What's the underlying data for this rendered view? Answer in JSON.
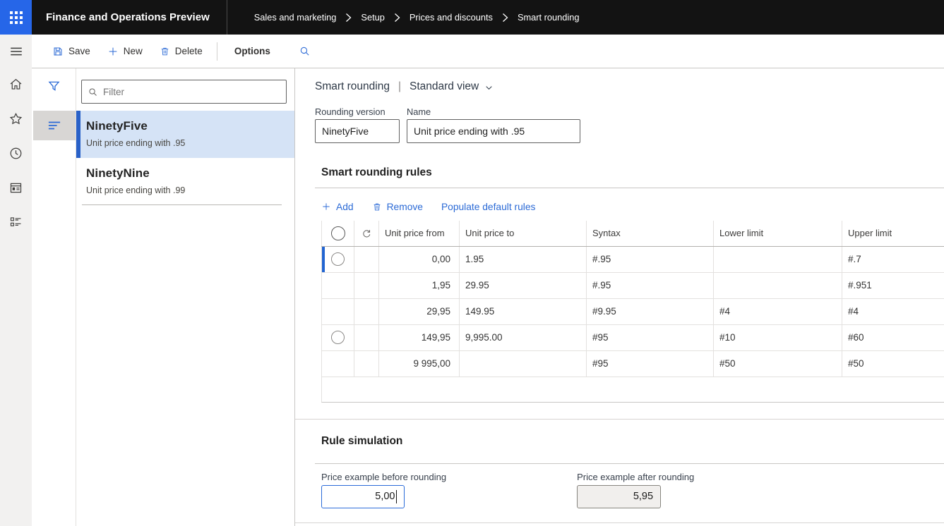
{
  "app_bar": {
    "product_title": "Finance and Operations Preview",
    "breadcrumb": [
      "Sales and marketing",
      "Setup",
      "Prices and discounts",
      "Smart rounding"
    ]
  },
  "command_bar": {
    "save_label": "Save",
    "new_label": "New",
    "delete_label": "Delete",
    "options_label": "Options"
  },
  "icons": {
    "waffle": "grid-3x3-dots",
    "nav": [
      "hamburger",
      "home",
      "star-favorites",
      "clock-recent",
      "workspace-window",
      "modules-checklist"
    ],
    "save": "floppy-disk",
    "new": "plus",
    "delete": "trash",
    "search": "magnifier",
    "filter": "funnel",
    "list_view": "list-lines",
    "view_chevron": "chevron-down",
    "breadcrumb_separator": "chevron-right",
    "grid_header": [
      "radio-circle",
      "refresh-arrow"
    ]
  },
  "master_list": {
    "filter_placeholder": "Filter",
    "items": [
      {
        "title": "NinetyFive",
        "subtitle": "Unit price ending with .95",
        "selected": true
      },
      {
        "title": "NinetyNine",
        "subtitle": "Unit price ending with .99",
        "selected": false
      }
    ]
  },
  "page": {
    "title": "Smart rounding",
    "separator": "|",
    "view_selector": "Standard view",
    "fields": [
      {
        "label": "Rounding version",
        "value": "NinetyFive"
      },
      {
        "label": "Name",
        "value": "Unit price ending with .95"
      }
    ]
  },
  "rules_section": {
    "title": "Smart rounding rules",
    "actions": {
      "add": "Add",
      "remove": "Remove",
      "populate": "Populate default rules"
    },
    "grid": {
      "columns": [
        "Unit price from",
        "Unit price to",
        "Syntax",
        "Lower limit",
        "Upper limit"
      ],
      "rows": [
        {
          "unit_price_from": "0,00",
          "unit_price_to": "1.95",
          "syntax": "#.95",
          "lower_limit": "",
          "upper_limit": "#.7",
          "state": "selected"
        },
        {
          "unit_price_from": "1,95",
          "unit_price_to": "29.95",
          "syntax": "#.95",
          "lower_limit": "",
          "upper_limit": "#.951",
          "state": "normal"
        },
        {
          "unit_price_from": "29,95",
          "unit_price_to": "149.95",
          "syntax": "#9.95",
          "lower_limit": "#4",
          "upper_limit": "#4",
          "state": "normal"
        },
        {
          "unit_price_from": "149,95",
          "unit_price_to": "9,995.00",
          "syntax": "#95",
          "lower_limit": "#10",
          "upper_limit": "#60",
          "state": "active"
        },
        {
          "unit_price_from": "9 995,00",
          "unit_price_to": "",
          "syntax": "#95",
          "lower_limit": "#50",
          "upper_limit": "#50",
          "state": "normal"
        }
      ]
    }
  },
  "simulation_section": {
    "title": "Rule simulation",
    "before": {
      "label": "Price example before rounding",
      "value": "5,00"
    },
    "after": {
      "label": "Price example after rounding",
      "value": "5,95"
    }
  },
  "colors": {
    "accent_blue": "#2b6ad6",
    "waffle_blue": "#2666e8",
    "appbar_black": "#131313",
    "selected_row_bg": "#d9e7f9",
    "selected_list_bg": "#d5e3f6",
    "active_row_bg": "#e9e8e7"
  }
}
